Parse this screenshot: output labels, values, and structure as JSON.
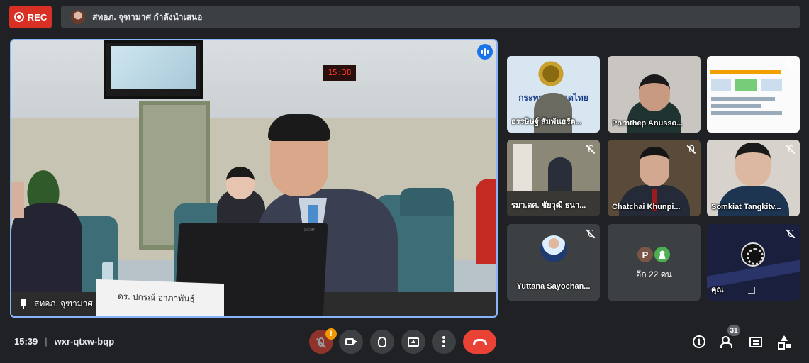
{
  "recording": {
    "label": "REC"
  },
  "presenting": {
    "text": "สทอภ. จุฑามาศ กำลังนำเสนอ"
  },
  "main_video": {
    "participant_name": "สทอภ. จุฑามาศ",
    "clock_text": "15:38",
    "nameplate_text": "ดร. ปกรณ์ อาภาพันธุ์"
  },
  "tiles": [
    {
      "name": "อรรษิษฐ์ สัมพันธรัต...",
      "muted": false,
      "banner": "กระทรวงมหาดไทย"
    },
    {
      "name": "Pornthep Anusso...",
      "muted": false
    },
    {
      "name": "",
      "muted": true
    },
    {
      "name": "รมว.ดศ. ชัยวุฒิ ธนา...",
      "muted": true
    },
    {
      "name": "Chatchai Khunpi...",
      "muted": true
    },
    {
      "name": "Somkiat Tangkitv...",
      "muted": true
    },
    {
      "name": "Yuttana Sayochan...",
      "muted": true
    },
    {
      "name": "",
      "others_label": "อีก 22 คน",
      "avatars": [
        "P",
        ""
      ]
    },
    {
      "name": "คุณ",
      "muted": true
    }
  ],
  "bottom_bar": {
    "time": "15:39",
    "separator": "|",
    "meeting_code": "wxr-qtxw-bqp",
    "mic_alert": "!",
    "people_count": "31"
  },
  "icons": {
    "info": "i"
  },
  "colors": {
    "background": "#202124",
    "rec": "#d93025",
    "active_border": "#8ab4f8",
    "leave": "#ea4335",
    "alert": "#f29900"
  }
}
